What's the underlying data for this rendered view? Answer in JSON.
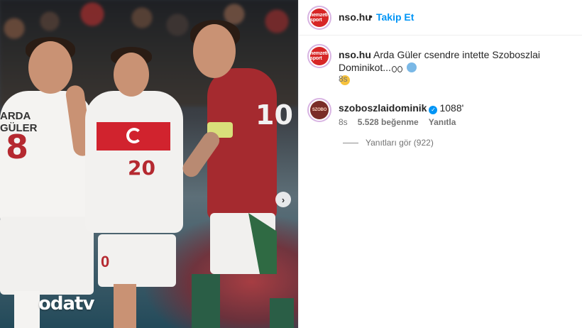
{
  "media": {
    "watermark": "odatv",
    "shirt_name": "ARDA GÜLER",
    "numbers": {
      "arda": "8",
      "middle": "20",
      "szobo": "10",
      "zero": "0"
    }
  },
  "header": {
    "username": "nso.hu",
    "separator": "•",
    "follow_label": "Takip Et",
    "avatar_text": "nemzeti sport"
  },
  "caption": {
    "username": "nso.hu",
    "text": "Arda Güler csendre intette Szoboszlai Dominikot...",
    "time": "8s"
  },
  "comment": {
    "username": "szoboszlaidominik",
    "text": "1088'",
    "time": "8s",
    "likes": "5.528 beğenme",
    "reply_label": "Yanıtla",
    "avatar_text": "SZOBO"
  },
  "replies": {
    "label": "Yanıtları gör (922)"
  },
  "colors": {
    "accent": "#0095f6",
    "text": "#262626",
    "muted": "#737373"
  }
}
